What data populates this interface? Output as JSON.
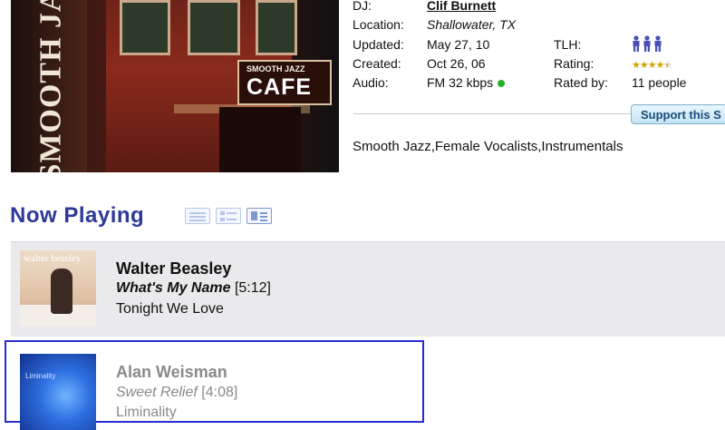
{
  "station": {
    "art": {
      "vertical_text": "SMOOTH JAZZ CAFE",
      "sign_small": "SMOOTH JAZZ",
      "sign_large": "CAFE"
    },
    "info": {
      "dj_label": "DJ:",
      "dj_name": "Clif Burnett",
      "location_label": "Location:",
      "location_value": "Shallowater, TX",
      "updated_label": "Updated:",
      "updated_value": "May 27, 10",
      "created_label": "Created:",
      "created_value": "Oct 26, 06",
      "audio_label": "Audio:",
      "audio_value": "FM 32 kbps",
      "audio_status_color": "#24b327",
      "tlh_label": "TLH:",
      "tlh_icon": "people-icon",
      "rating_label": "Rating:",
      "rating_stars": 4.5,
      "rating_max": 5,
      "rated_by_label": "Rated by:",
      "rated_by_value": "11 people"
    },
    "support_button": "Support this S",
    "genres": "Smooth Jazz,Female Vocalists,Instrumentals"
  },
  "now_playing": {
    "title": "Now Playing",
    "view_icons": [
      "list-view-icon",
      "detail-view-icon",
      "cover-view-icon"
    ],
    "tracks": [
      {
        "art_text": "walter beasley",
        "artist": "Walter Beasley",
        "song": "What's My Name",
        "duration": "[5:12]",
        "album": "Tonight We Love"
      },
      {
        "art_text": "Liminality",
        "artist": "Alan Weisman",
        "song": "Sweet Relief",
        "duration": "[4:08]",
        "album": "Liminality"
      }
    ]
  },
  "colors": {
    "heading": "#2d3a97",
    "highlight_border": "#2b2bd2",
    "row_background": "#eaeaed",
    "stars": "#d6a400"
  }
}
